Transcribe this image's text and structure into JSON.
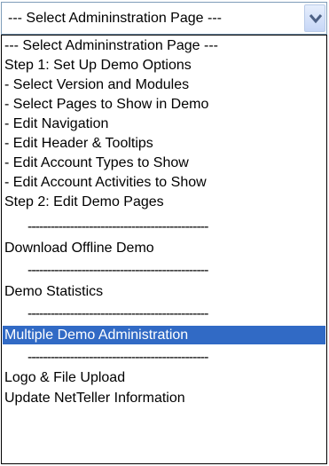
{
  "select": {
    "current_value": "--- Select Admininstration Page ---",
    "arrow_icon": "chevron-down-icon",
    "arrow_color": "#4d6185"
  },
  "dropdown": {
    "options": [
      "--- Select Admininstration Page ---",
      "Step 1: Set Up Demo Options",
      "- Select Version and Modules",
      "- Select Pages to Show in Demo",
      "- Edit Navigation",
      "- Edit Header & Tooltips",
      "- Edit Account Types to Show",
      "- Edit Account Activities to Show",
      "Step 2: Edit Demo Pages",
      "-----------------------------------------------",
      "Download Offline Demo",
      "-----------------------------------------------",
      "Demo Statistics",
      "-----------------------------------------------",
      "Multiple Demo Administration",
      "-----------------------------------------------",
      "Logo & File Upload",
      "Update NetTeller Information"
    ],
    "highlighted_option": "Multiple Demo Administration",
    "highlight_color": "#316ac5"
  }
}
